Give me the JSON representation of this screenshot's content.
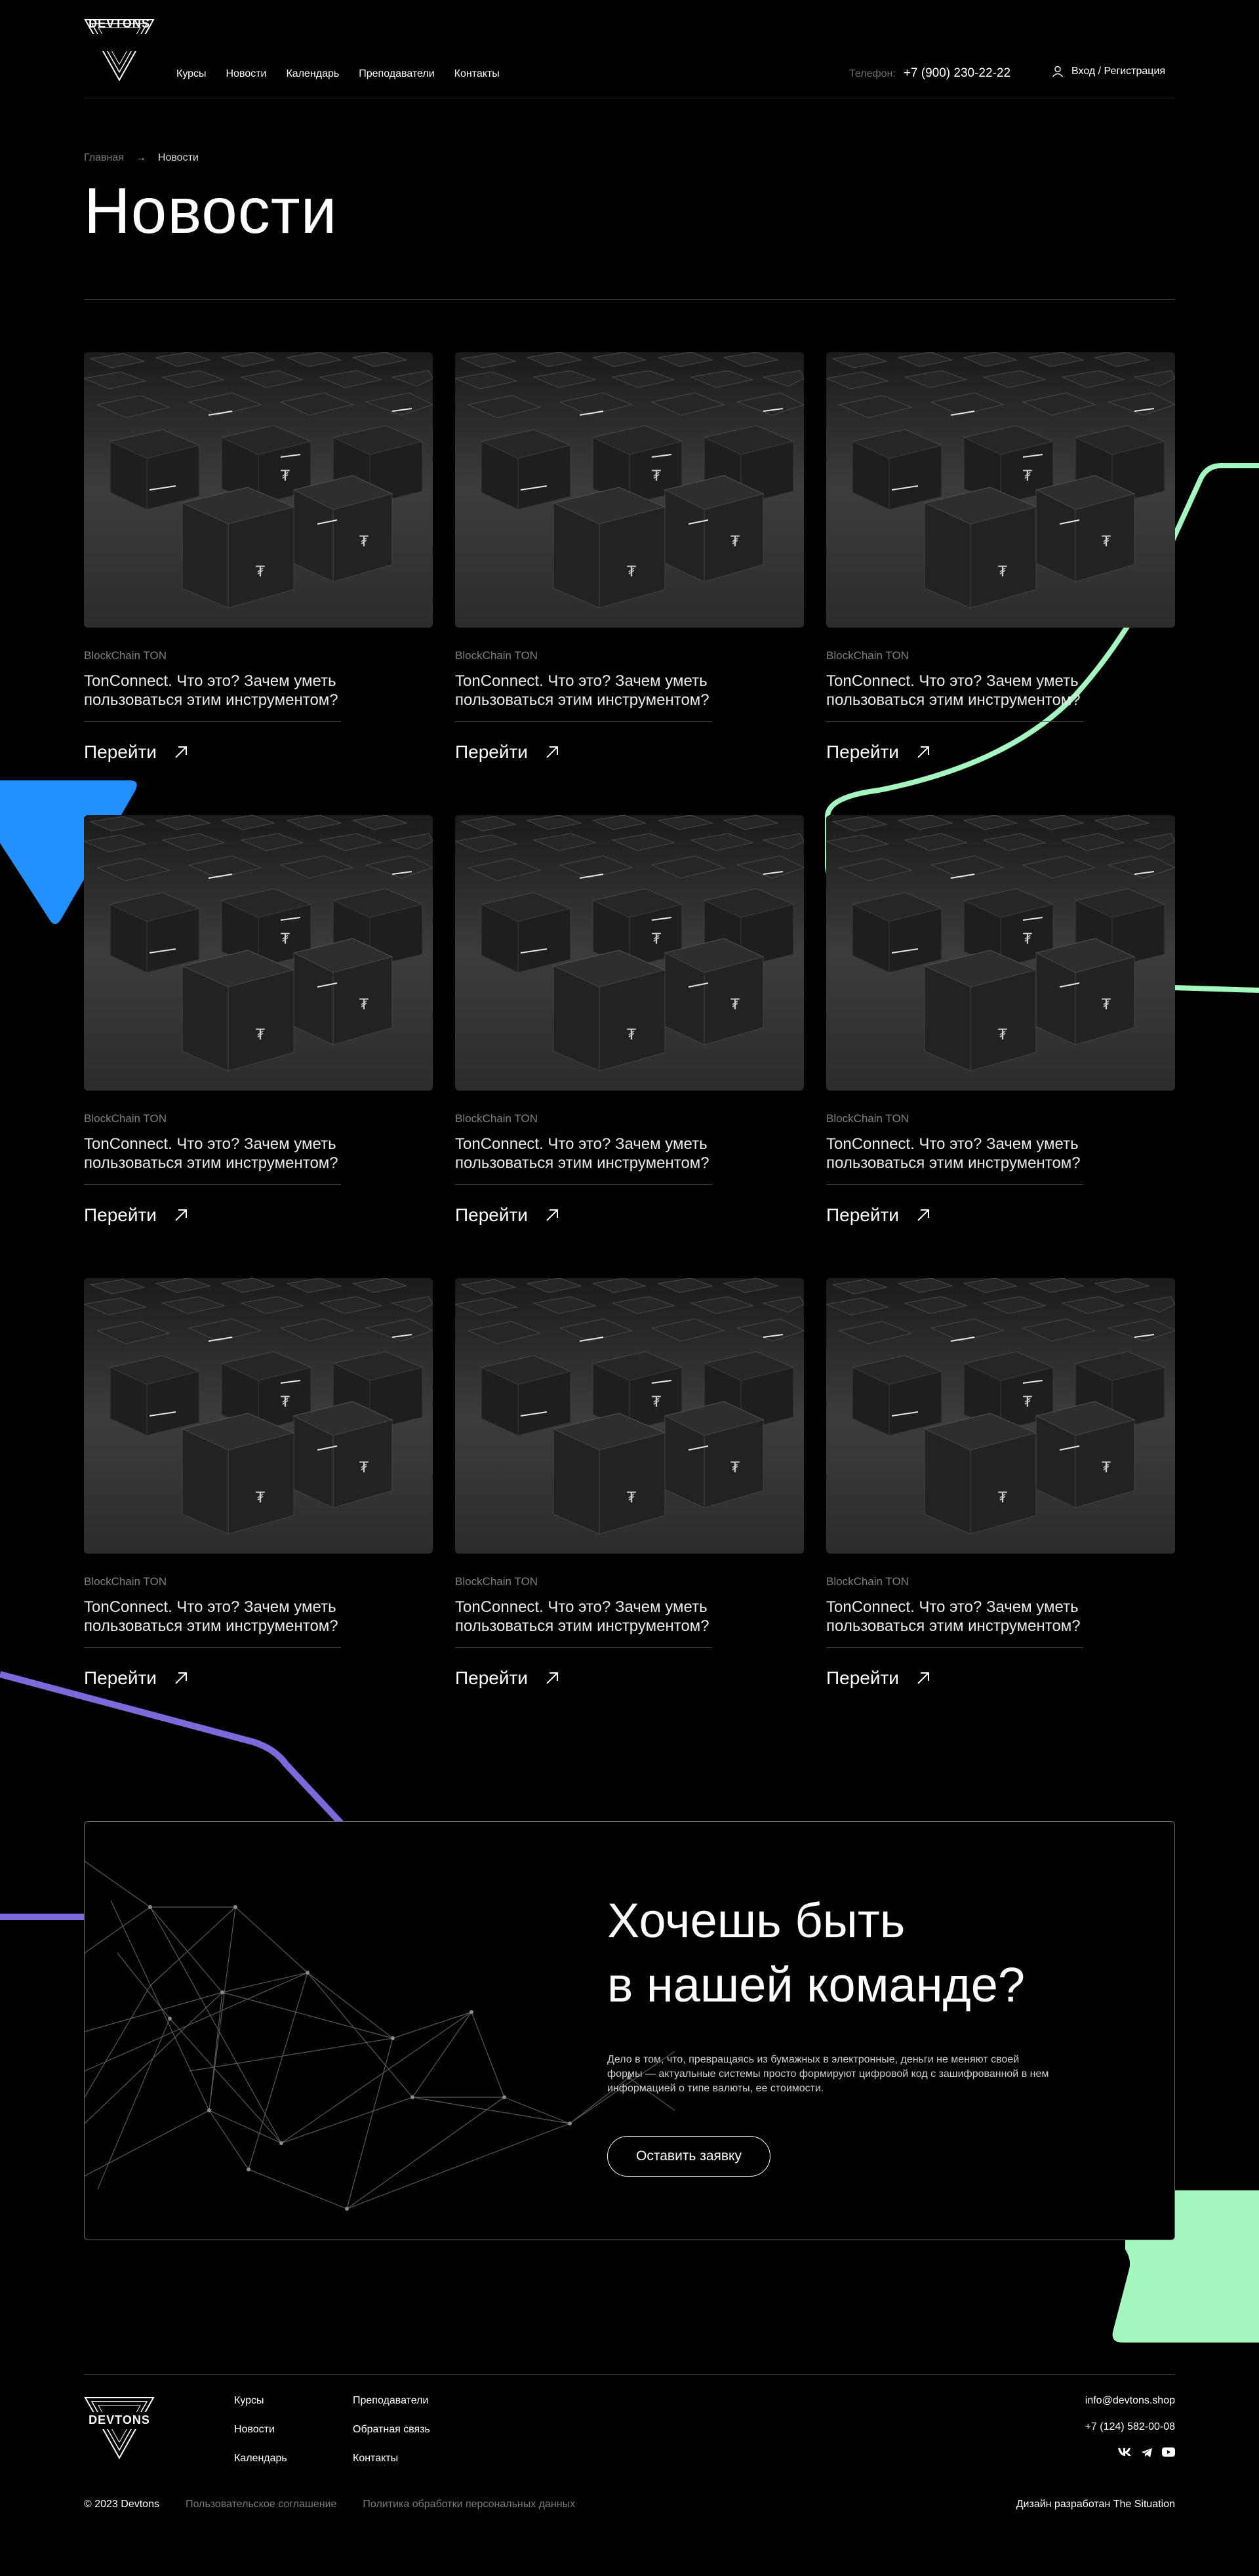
{
  "brand": {
    "logo_text": "DEVTONS"
  },
  "nav": {
    "items": [
      "Курсы",
      "Новости",
      "Календарь",
      "Преподаватели",
      "Контакты"
    ]
  },
  "contact": {
    "phone_label": "Телефон:",
    "phone": "+7 (900) 230-22-22",
    "login": "Вход / Регистрация"
  },
  "breadcrumb": {
    "home": "Главная",
    "arrow": "→",
    "current": "Новости"
  },
  "page": {
    "title": "Новости"
  },
  "news": [
    {
      "tag": "BlockChain TON",
      "title": "TonConnect. Что это? Зачем уметь пользоваться этим инструментом?",
      "link": "Перейти"
    },
    {
      "tag": "BlockChain TON",
      "title": "TonConnect. Что это? Зачем уметь пользоваться этим инструментом?",
      "link": "Перейти"
    },
    {
      "tag": "BlockChain TON",
      "title": "TonConnect. Что это? Зачем уметь пользоваться этим инструментом?",
      "link": "Перейти"
    },
    {
      "tag": "BlockChain TON",
      "title": "TonConnect. Что это? Зачем уметь пользоваться этим инструментом?",
      "link": "Перейти"
    },
    {
      "tag": "BlockChain TON",
      "title": "TonConnect. Что это? Зачем уметь пользоваться этим инструментом?",
      "link": "Перейти"
    },
    {
      "tag": "BlockChain TON",
      "title": "TonConnect. Что это? Зачем уметь пользоваться этим инструментом?",
      "link": "Перейти"
    },
    {
      "tag": "BlockChain TON",
      "title": "TonConnect. Что это? Зачем уметь пользоваться этим инструментом?",
      "link": "Перейти"
    },
    {
      "tag": "BlockChain TON",
      "title": "TonConnect. Что это? Зачем уметь пользоваться этим инструментом?",
      "link": "Перейти"
    },
    {
      "tag": "BlockChain TON",
      "title": "TonConnect. Что это? Зачем уметь пользоваться этим инструментом?",
      "link": "Перейти"
    }
  ],
  "cta": {
    "title_line1": "Хочешь быть",
    "title_line2": "в нашей команде?",
    "text": "Дело в том, что, превращаясь из бумажных в электронные, деньги не меняют своей формы — актуальные системы просто формируют цифровой код с зашифрованной в нем информацией о типе валюты, ее стоимости.",
    "button": "Оставить заявку"
  },
  "footer": {
    "col1": [
      "Курсы",
      "Новости",
      "Календарь"
    ],
    "col2": [
      "Преподаватели",
      "Обратная связь",
      "Контакты"
    ],
    "email": "info@devtons.shop",
    "phone": "+7 (124) 582-00-08",
    "social": [
      "vk-icon",
      "telegram-icon",
      "youtube-icon"
    ],
    "copyright": "© 2023 Devtons",
    "agreement": "Пользовательское соглашение",
    "privacy": "Политика обработки персональных данных",
    "design": "Дизайн разработан The Situation"
  },
  "colors": {
    "mint": "#a3f7bf",
    "blue": "#2291ff",
    "purple": "#7b6ad9",
    "background": "#000000"
  }
}
